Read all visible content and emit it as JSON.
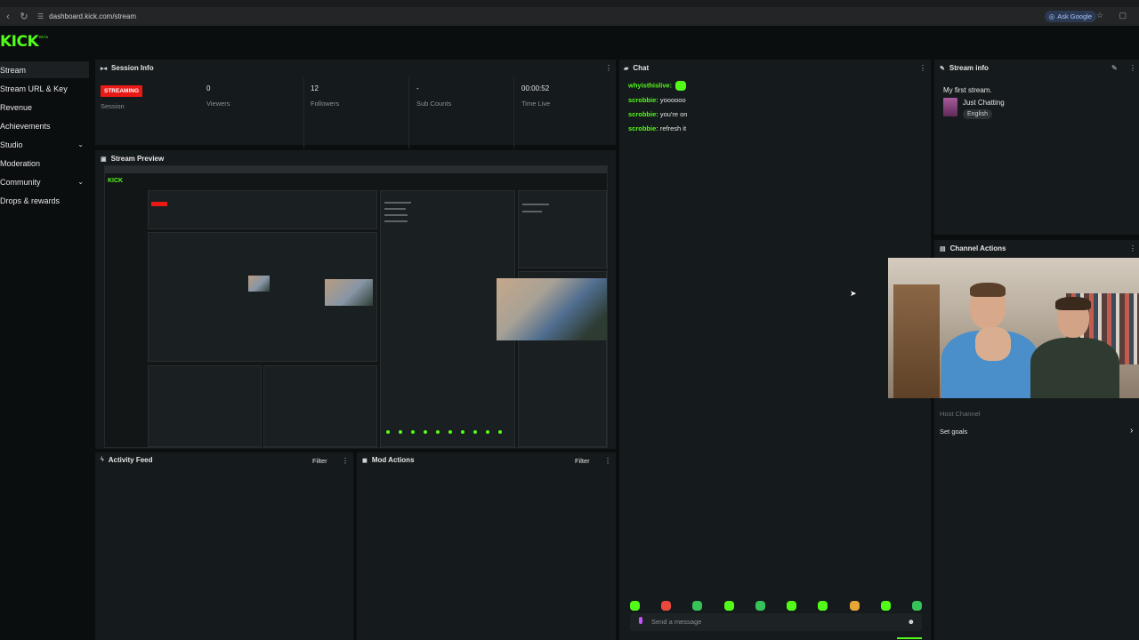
{
  "browser": {
    "url": "dashboard.kick.com/stream",
    "ask_google": "Ask Google"
  },
  "app": {
    "logo": "KICK",
    "logo_sup": "BETA"
  },
  "sidebar": {
    "items": [
      {
        "label": "Stream"
      },
      {
        "label": "Stream URL & Key"
      },
      {
        "label": "Revenue"
      },
      {
        "label": "Achievements"
      },
      {
        "label": "Studio"
      },
      {
        "label": "Moderation"
      },
      {
        "label": "Community"
      },
      {
        "label": "Drops & rewards"
      }
    ]
  },
  "session_info": {
    "title": "Session Info",
    "status_badge": "STREAMING",
    "session_label": "Session",
    "stats": [
      {
        "value": "0",
        "label": "Viewers"
      },
      {
        "value": "12",
        "label": "Followers"
      },
      {
        "value": "-",
        "label": "Sub Counts"
      },
      {
        "value": "00:00:52",
        "label": "Time Live"
      }
    ]
  },
  "stream_preview": {
    "title": "Stream Preview"
  },
  "chat": {
    "title": "Chat",
    "messages": [
      {
        "user": "whyisthislive:",
        "text": ""
      },
      {
        "user": "scrobbie:",
        "text": "yoooooo"
      },
      {
        "user": "scrobbie:",
        "text": "you're on"
      },
      {
        "user": "scrobbie:",
        "text": "refresh it"
      }
    ],
    "input_placeholder": "Send a message"
  },
  "stream_info": {
    "title": "Stream info",
    "stream_title": "My first stream.",
    "category": "Just Chatting",
    "language": "English"
  },
  "channel_actions": {
    "title": "Channel Actions",
    "host_channel": "Host Channel",
    "set_goals": "Set goals"
  },
  "activity_feed": {
    "title": "Activity Feed",
    "filter": "Filter"
  },
  "mod_actions": {
    "title": "Mod Actions",
    "filter": "Filter"
  },
  "colors": {
    "accent": "#53fc18",
    "live_badge": "#e91916",
    "panel_bg": "#151a1c",
    "page_bg": "#0b0e0f"
  }
}
